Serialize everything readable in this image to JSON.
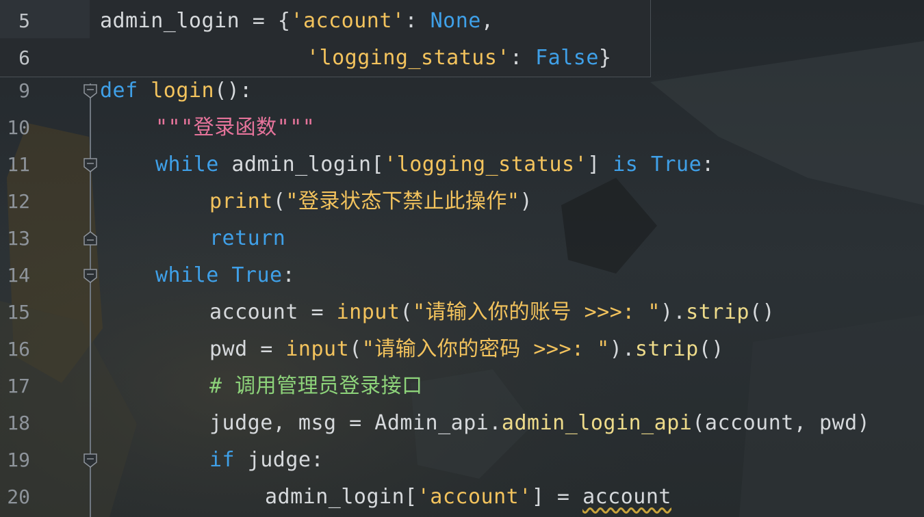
{
  "sticky_header": {
    "lines": [
      {
        "number": "5",
        "segments": [
          {
            "text": "admin_login = {",
            "cls": "t-plain"
          },
          {
            "text": "'account'",
            "cls": "t-str"
          },
          {
            "text": ": ",
            "cls": "t-plain"
          },
          {
            "text": "None",
            "cls": "t-kw"
          },
          {
            "text": ",",
            "cls": "t-plain"
          }
        ]
      },
      {
        "number": "6",
        "segments": [
          {
            "text": "'logging_status'",
            "cls": "t-str"
          },
          {
            "text": ": ",
            "cls": "t-plain"
          },
          {
            "text": "False",
            "cls": "t-kw"
          },
          {
            "text": "}",
            "cls": "t-plain"
          }
        ]
      }
    ]
  },
  "code_lines": [
    {
      "number": "9",
      "segments": [
        {
          "text": "def",
          "cls": "t-kw"
        },
        {
          "text": " ",
          "cls": "t-plain"
        },
        {
          "text": "login",
          "cls": "t-fn"
        },
        {
          "text": "():",
          "cls": "t-plain"
        }
      ]
    },
    {
      "number": "10",
      "segments": [
        {
          "text": "\"\"\"登录函数\"\"\"",
          "cls": "t-doc"
        }
      ]
    },
    {
      "number": "11",
      "segments": [
        {
          "text": "while",
          "cls": "t-kw"
        },
        {
          "text": " admin_login[",
          "cls": "t-plain"
        },
        {
          "text": "'logging_status'",
          "cls": "t-str"
        },
        {
          "text": "] ",
          "cls": "t-plain"
        },
        {
          "text": "is",
          "cls": "t-kw"
        },
        {
          "text": " ",
          "cls": "t-plain"
        },
        {
          "text": "True",
          "cls": "t-kw"
        },
        {
          "text": ":",
          "cls": "t-plain"
        }
      ]
    },
    {
      "number": "12",
      "segments": [
        {
          "text": "print",
          "cls": "t-fn"
        },
        {
          "text": "(",
          "cls": "t-plain"
        },
        {
          "text": "\"登录状态下禁止此操作\"",
          "cls": "t-str"
        },
        {
          "text": ")",
          "cls": "t-plain"
        }
      ]
    },
    {
      "number": "13",
      "segments": [
        {
          "text": "return",
          "cls": "t-kw"
        }
      ]
    },
    {
      "number": "14",
      "segments": [
        {
          "text": "while",
          "cls": "t-kw"
        },
        {
          "text": " ",
          "cls": "t-plain"
        },
        {
          "text": "True",
          "cls": "t-kw"
        },
        {
          "text": ":",
          "cls": "t-plain"
        }
      ]
    },
    {
      "number": "15",
      "segments": [
        {
          "text": "account = ",
          "cls": "t-plain"
        },
        {
          "text": "input",
          "cls": "t-fn"
        },
        {
          "text": "(",
          "cls": "t-plain"
        },
        {
          "text": "\"请输入你的账号 >>>: \"",
          "cls": "t-str"
        },
        {
          "text": ").",
          "cls": "t-plain"
        },
        {
          "text": "strip",
          "cls": "t-method"
        },
        {
          "text": "()",
          "cls": "t-plain"
        }
      ]
    },
    {
      "number": "16",
      "segments": [
        {
          "text": "pwd = ",
          "cls": "t-plain"
        },
        {
          "text": "input",
          "cls": "t-fn"
        },
        {
          "text": "(",
          "cls": "t-plain"
        },
        {
          "text": "\"请输入你的密码 >>>: \"",
          "cls": "t-str"
        },
        {
          "text": ").",
          "cls": "t-plain"
        },
        {
          "text": "strip",
          "cls": "t-method"
        },
        {
          "text": "()",
          "cls": "t-plain"
        }
      ]
    },
    {
      "number": "17",
      "segments": [
        {
          "text": "# 调用管理员登录接口",
          "cls": "t-cmt"
        }
      ]
    },
    {
      "number": "18",
      "segments": [
        {
          "text": "judge, msg = Admin_api.",
          "cls": "t-plain"
        },
        {
          "text": "admin_login_api",
          "cls": "t-method"
        },
        {
          "text": "(account, pwd)",
          "cls": "t-plain"
        }
      ]
    },
    {
      "number": "19",
      "segments": [
        {
          "text": "if",
          "cls": "t-kw"
        },
        {
          "text": " judge:",
          "cls": "t-plain"
        }
      ]
    },
    {
      "number": "20",
      "segments": [
        {
          "text": "admin_login[",
          "cls": "t-plain"
        },
        {
          "text": "'account'",
          "cls": "t-str"
        },
        {
          "text": "] = ",
          "cls": "t-plain"
        },
        {
          "text": "account",
          "cls": "t-plain t-warn"
        }
      ]
    }
  ],
  "colors": {
    "keyword": "#3fa0e8",
    "function": "#f3c35d",
    "string": "#f3c35d",
    "docstring": "#e6749b",
    "comment": "#8dd37a",
    "text": "#d6d9dc",
    "line_number": "#8e949b"
  },
  "icons": {
    "fold_open": "fold-open-icon",
    "fold_close": "fold-close-icon",
    "warning_underline": "wavy-underline"
  }
}
